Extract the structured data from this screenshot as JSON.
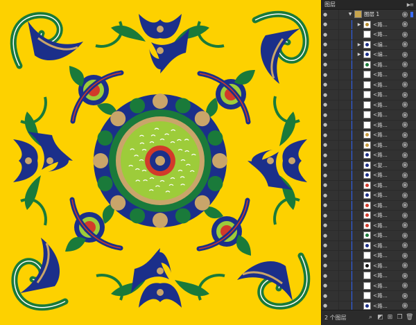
{
  "panel": {
    "title": "图层",
    "menu_glyph": "▶≡",
    "layers": [
      {
        "label": "图层 1",
        "kind": "top",
        "tri": "▼"
      },
      {
        "label": "<路...",
        "tri": "▶",
        "thumb_color": "#b58b2a"
      },
      {
        "label": "<路...",
        "tri": "",
        "thumb_color": ""
      },
      {
        "label": "<编...",
        "tri": "▶",
        "thumb_color": "#1b2f8a"
      },
      {
        "label": "<编...",
        "tri": "▶",
        "thumb_color": "#1b2f8a"
      },
      {
        "label": "<路...",
        "tri": "",
        "thumb_color": "#1a7a3a"
      },
      {
        "label": "<路...",
        "tri": "",
        "thumb_color": ""
      },
      {
        "label": "<路...",
        "tri": "",
        "thumb_color": ""
      },
      {
        "label": "<路...",
        "tri": "",
        "thumb_color": ""
      },
      {
        "label": "<路...",
        "tri": "",
        "thumb_color": ""
      },
      {
        "label": "<路...",
        "tri": "",
        "thumb_color": ""
      },
      {
        "label": "<路...",
        "tri": "",
        "thumb_color": ""
      },
      {
        "label": "<路...",
        "tri": "",
        "thumb_color": "#c79a3a"
      },
      {
        "label": "<路...",
        "tri": "",
        "thumb_color": "#c79a3a"
      },
      {
        "label": "<路...",
        "tri": "",
        "thumb_color": "#1b2f8a"
      },
      {
        "label": "<复...",
        "tri": "",
        "thumb_color": "#1b2f8a"
      },
      {
        "label": "<路...",
        "tri": "",
        "thumb_color": "#1b2f8a"
      },
      {
        "label": "<路...",
        "tri": "",
        "thumb_color": "#d23a2a"
      },
      {
        "label": "<路...",
        "tri": "",
        "thumb_color": "#1b2f8a"
      },
      {
        "label": "<路...",
        "tri": "",
        "thumb_color": "#d23a2a"
      },
      {
        "label": "<路...",
        "tri": "",
        "thumb_color": "#d23a2a"
      },
      {
        "label": "<路...",
        "tri": "",
        "thumb_color": "#d23a2a"
      },
      {
        "label": "<路...",
        "tri": "",
        "thumb_color": "#1a7a3a"
      },
      {
        "label": "<路...",
        "tri": "",
        "thumb_color": "#1b2f8a"
      },
      {
        "label": "<路...",
        "tri": "",
        "thumb_color": ""
      },
      {
        "label": "<路...",
        "tri": "",
        "thumb_color": "#111111"
      },
      {
        "label": "<路...",
        "tri": "",
        "thumb_color": ""
      },
      {
        "label": "<路...",
        "tri": "",
        "thumb_color": ""
      },
      {
        "label": "<路...",
        "tri": "",
        "thumb_color": ""
      },
      {
        "label": "<路...",
        "tri": "",
        "thumb_color": "#1b2f8a"
      },
      {
        "label": "<路...",
        "tri": "",
        "thumb_color": "#1b2f8a"
      },
      {
        "label": "<路...",
        "tri": "",
        "thumb_color": "#1b2f8a"
      }
    ],
    "footer": {
      "count": "2 个图层",
      "icons": [
        "locate-object-icon",
        "make-clipping-mask-icon",
        "create-sublayer-icon",
        "new-layer-icon",
        "delete-icon"
      ]
    }
  },
  "colors": {
    "yellow": "#FDD100",
    "navy": "#1b2f8a",
    "green": "#1a7a3a",
    "lime": "#9dcc3a",
    "red": "#d23a2a",
    "tan": "#c9a56a",
    "white": "#ffffff",
    "panel_bg": "#323232",
    "selection_blue": "#3b6cff"
  }
}
